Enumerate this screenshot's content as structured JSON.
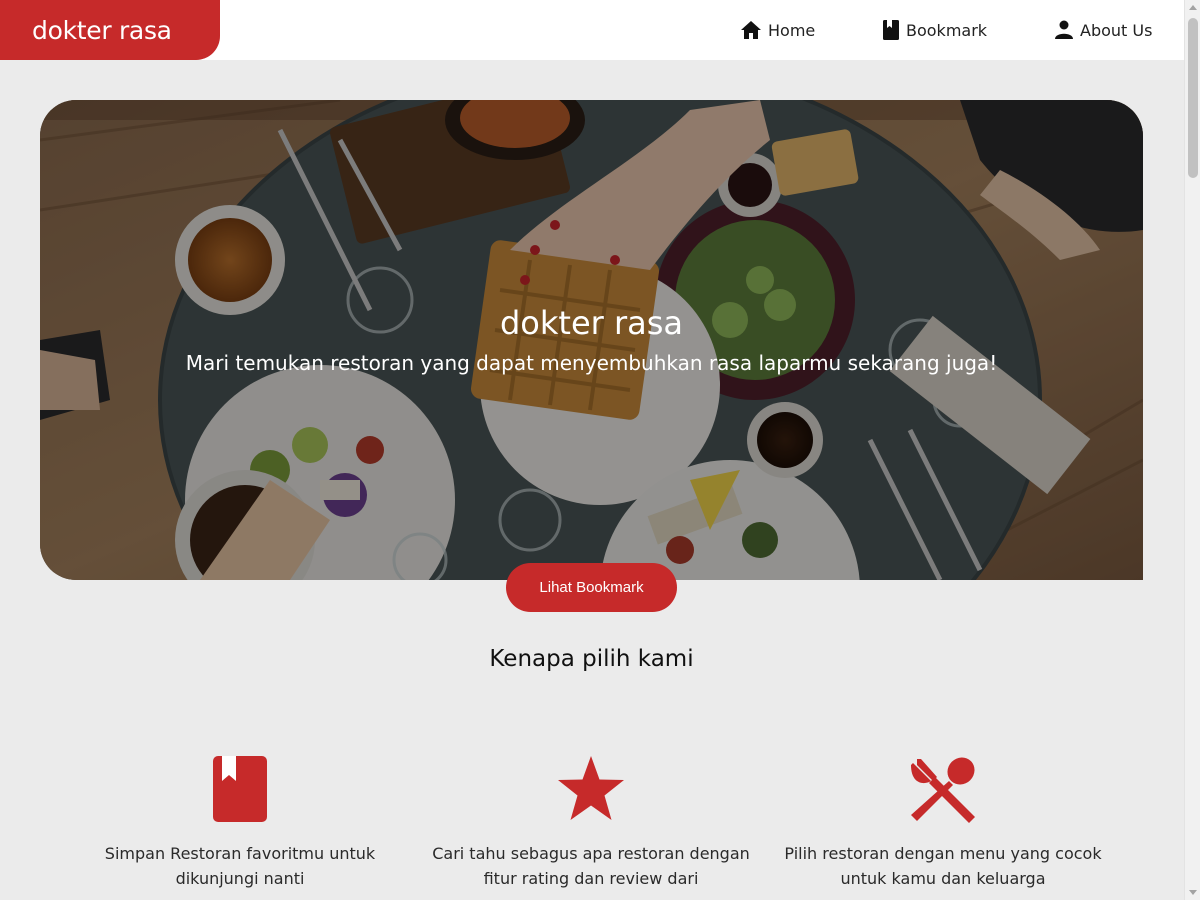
{
  "header": {
    "brand": "dokter rasa",
    "nav": [
      {
        "label": "Home",
        "icon": "home-icon"
      },
      {
        "label": "Bookmark",
        "icon": "book-icon"
      },
      {
        "label": "About Us",
        "icon": "person-icon"
      }
    ]
  },
  "hero": {
    "title": "dokter rasa",
    "subtitle": "Mari temukan restoran yang dapat menyembuhkan rasa laparmu sekarang juga!",
    "cta_label": "Lihat Bookmark"
  },
  "why": {
    "title": "Kenapa pilih kami",
    "features": [
      {
        "icon": "bookmark-book-icon",
        "text": "Simpan Restoran favoritmu untuk dikunjungi nanti"
      },
      {
        "icon": "star-icon",
        "text": "Cari tahu sebagus apa restoran dengan fitur rating dan review dari"
      },
      {
        "icon": "restaurant-utensils-icon",
        "text": "Pilih restoran dengan menu yang cocok untuk kamu dan keluarga"
      }
    ]
  },
  "colors": {
    "accent": "#c62a2a",
    "background": "#ebebeb",
    "header": "#ffffff"
  }
}
